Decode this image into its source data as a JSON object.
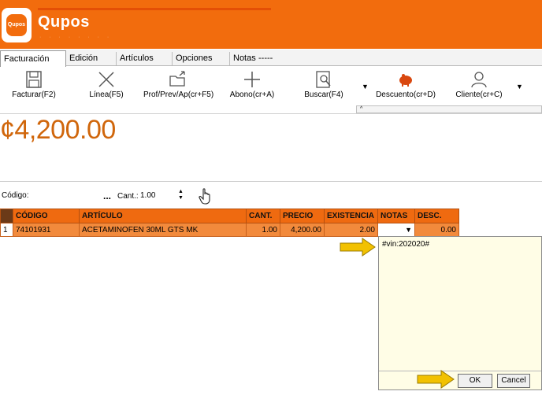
{
  "app": {
    "brand": "Qupos",
    "logo_text": "Qupos"
  },
  "tabs": [
    {
      "label": "Facturación",
      "active": true
    },
    {
      "label": "Edición"
    },
    {
      "label": "Artículos"
    },
    {
      "label": "Opciones"
    },
    {
      "label": "Notas"
    },
    {
      "label": "-----"
    }
  ],
  "toolbar": {
    "facturar": "Facturar(F2)",
    "linea": "Línea(F5)",
    "prof": "Prof/Prev/Ap(cr+F5)",
    "abono": "Abono(cr+A)",
    "buscar": "Buscar(F4)",
    "descuento": "Descuento(cr+D)",
    "cliente": "Cliente(cr+C)",
    "mini_scroll": "^"
  },
  "total": "¢4,200.00",
  "entry": {
    "codigo_label": "Código:",
    "ellipsis": "...",
    "cant_label": "Cant.:",
    "cant_value": "1.00"
  },
  "grid": {
    "headers": [
      "CÓDIGO",
      "ARTÍCULO",
      "CANT.",
      "PRECIO",
      "EXISTENCIA",
      "NOTAS",
      "DESC."
    ],
    "rows": [
      {
        "index": "1",
        "codigo": "74101931",
        "articulo": "ACETAMINOFEN 30ML GTS MK",
        "cant": "1.00",
        "precio": "4,200.00",
        "existencia": "2.00",
        "notas_arrow": "▼",
        "desc": "0.00"
      }
    ]
  },
  "notes_popup": {
    "text": "#vin:202020#",
    "ok": "OK",
    "cancel": "Cancel"
  },
  "colors": {
    "brand_orange": "#f26c0d",
    "row_orange": "#f28a3c",
    "total_orange": "#d0660b",
    "arrow_yellow": "#f2c100",
    "popup_bg": "#fffde6"
  }
}
